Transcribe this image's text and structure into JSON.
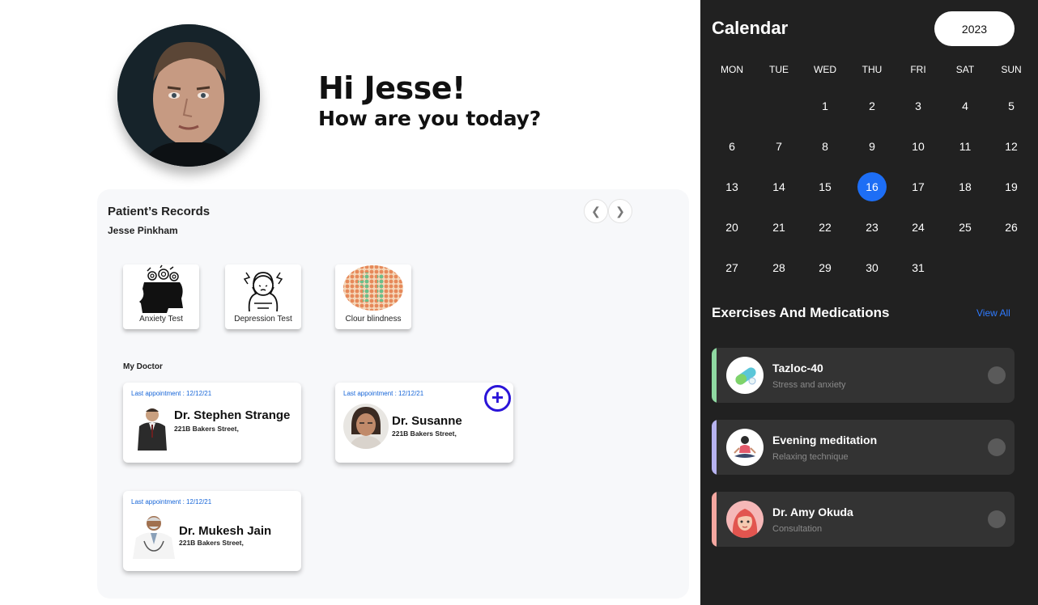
{
  "greeting": {
    "hello": "Hi Jesse!",
    "question": "How are you today?"
  },
  "records": {
    "title": "Patient’s Records",
    "patient_name": "Jesse Pinkham",
    "tests": [
      {
        "label": "Anxiety Test",
        "icon": "anxiety-head-icon"
      },
      {
        "label": "Depression Test",
        "icon": "depressed-person-icon"
      },
      {
        "label": "Clour blindness",
        "icon": "color-plate-icon"
      }
    ],
    "doctor_heading": "My Doctor",
    "doctors": [
      {
        "appointment": "Last appointment : 12/12/21",
        "name": "Dr. Stephen Strange",
        "address": "221B Bakers Street,"
      },
      {
        "appointment": "Last appointment : 12/12/21",
        "name": "Dr. Susanne",
        "address": "221B Bakers Street,"
      },
      {
        "appointment": "Last appointment : 12/12/21",
        "name": "Dr. Mukesh Jain",
        "address": "221B Bakers Street,"
      }
    ],
    "add_symbol": "+"
  },
  "calendar": {
    "title": "Calendar",
    "year": "2023",
    "weekdays": [
      "MON",
      "TUE",
      "WED",
      "THU",
      "FRI",
      "SAT",
      "SUN"
    ],
    "days": [
      "1",
      "2",
      "3",
      "4",
      "5",
      "6",
      "7",
      "8",
      "9",
      "10",
      "11",
      "12",
      "13",
      "14",
      "15",
      "16",
      "17",
      "18",
      "19",
      "20",
      "21",
      "22",
      "23",
      "24",
      "25",
      "26",
      "27",
      "28",
      "29",
      "30",
      "31"
    ],
    "selected_day": "16",
    "selected_color": "#1d6ef5"
  },
  "exercises": {
    "title": "Exercises And Medications",
    "view_all": "View All",
    "items": [
      {
        "title": "Tazloc-40",
        "subtitle": "Stress and anxiety",
        "accent": "#8fd9a2",
        "icon": "pill-capsule-icon"
      },
      {
        "title": "Evening meditation",
        "subtitle": "Relaxing technique",
        "accent": "#b7b3f0",
        "icon": "meditation-person-icon"
      },
      {
        "title": "Dr. Amy Okuda",
        "subtitle": "Consultation",
        "accent": "#f4a7a0",
        "icon": "doctor-avatar-icon"
      }
    ]
  }
}
